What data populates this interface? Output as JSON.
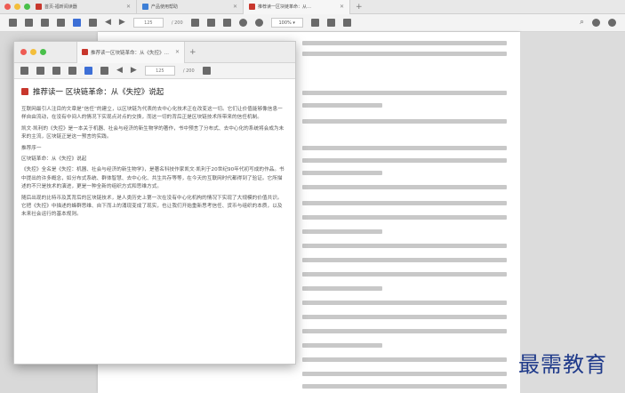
{
  "app_tabs": [
    {
      "label": "首页-福昕阅读器",
      "icon": "home-icon"
    },
    {
      "label": "产品使用帮助",
      "icon": "help-icon"
    },
    {
      "label": "推荐读一区块链革命：从…",
      "icon": "pdf-icon"
    }
  ],
  "toolbar": {
    "page_input": "125",
    "page_total": "/ 200",
    "zoom": "100% ▾"
  },
  "window": {
    "tab_label": "推荐读一区块链革命：从《失控》…",
    "page_input": "125",
    "page_total": "/ 200"
  },
  "document": {
    "title": "推荐读一 区块链革命：从《失控》说起",
    "paragraphs": [
      "互联网最引人注目的文章是“信任”的建立，以区块链为代表的去中心化技术正在改变这一切。它们让价值能够像信息一样自由流动，在没有中间人的情况下实现点对点的交换，而这一切的背后正是区块链技术所带来的信任机制。",
      "凯文·凯利的《失控》是一本关于机器、社会与经济的新生物学的著作，书中预言了分布式、去中心化的系统将会成为未来的主流，区块链正是这一预言的实践。",
      "推荐序一",
      "区块链革命：从《失控》说起",
      "《失控》全名是《失控：机器、社会与经济的新生物学》，是著名科技作家凯文·凯利于20世纪90年代初写成的作品。书中提出的许多概念，如分布式系统、群体智慧、去中心化、共生共存等等，在今天的互联网时代都得到了验证。它所描述的不只是技术的演进，更是一种全新的组织方式和思维方式。",
      "随后出现的比特币及其背后的区块链技术，是人类历史上第一次在没有中心化机构的情况下实现了大规模的价值共识。它把《失控》中描述的蜂群思维、自下而上的涌现变成了现实，也让我们开始重新思考信任、货币与组织的本质，以及未来社会运行的基本规则。"
    ]
  },
  "watermark": "最需教育"
}
